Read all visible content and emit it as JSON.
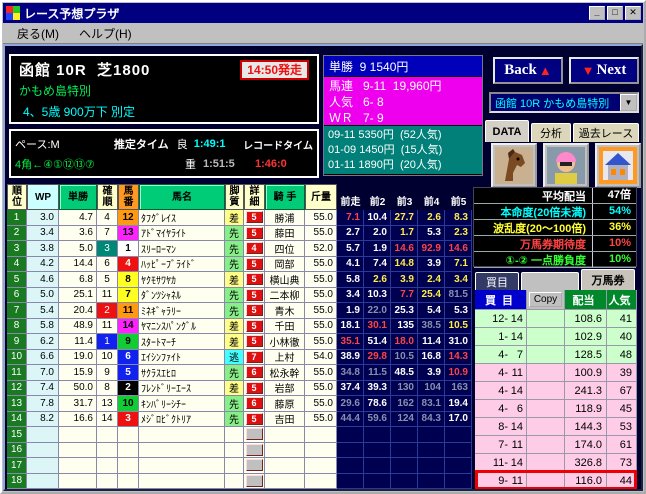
{
  "window": {
    "title": "レース予想プラザ",
    "menu": {
      "back": "戻る(M)",
      "help": "ヘルプ(H)"
    }
  },
  "race_info": {
    "title": "函館 10R  芝1800",
    "start_time": "14:50発走",
    "race_name": "かもめ島特別",
    "conditions": "4、5歳 900万下 別定"
  },
  "pace": {
    "pace": "ペース:M",
    "estimate_label": "推定タイム",
    "good_label": "良",
    "good_time": "1:49:1",
    "record_label": "レコードタイム",
    "corner_order": "4角←④①⑫⑬⑦",
    "heavy_label": "重",
    "heavy_time": "1:51:5",
    "record_time": "1:46:0"
  },
  "payouts": {
    "win": "単勝  9 1540円",
    "quinella": "馬連   9-11  19,960円",
    "popularity": "人気   6- 8",
    "wr": "ＷＲ   7- 9",
    "history": [
      "09-11 5350円  (52人気)",
      "01-09 1450円  (15人気)",
      "01-11 1890円  (20人気)"
    ]
  },
  "nav": {
    "back_label": "Back",
    "next_label": "Next",
    "race_selector": "函館 10R かもめ島特別",
    "tabs": {
      "data": "DATA",
      "analysis": "分析",
      "past": "過去レース"
    },
    "icons": [
      "horse-photo",
      "jockey-photo",
      "stable-photo"
    ]
  },
  "table": {
    "headers": {
      "rank": "順\n位",
      "wp": "WP",
      "odds": "単勝",
      "carank": "確\n順",
      "num": "馬\n番",
      "name": "馬名",
      "style": "脚\n質",
      "detail": "詳\n細",
      "jockey": "騎 手",
      "weight": "斤量",
      "past": [
        "前走",
        "前2",
        "前3",
        "前4",
        "前5"
      ]
    },
    "rows": [
      {
        "rank": "1",
        "wp": "3.0",
        "odds": "4.7",
        "co": "4",
        "co_mark": "",
        "num": "12",
        "num_color": "or",
        "name": "ﾀﾌｸﾞﾚｲｽ",
        "style": "差",
        "detail": "5",
        "jockey": "勝浦",
        "weight": "55.0",
        "past": [
          [
            "7.1",
            "r"
          ],
          [
            "10.4",
            "w"
          ],
          [
            "27.7",
            "y"
          ],
          [
            "2.6",
            "y"
          ],
          [
            "8.3",
            "y"
          ]
        ]
      },
      {
        "rank": "2",
        "wp": "3.4",
        "odds": "3.6",
        "co": "7",
        "co_mark": "",
        "num": "13",
        "num_color": "pk",
        "name": "ｱﾄﾞﾏｲﾔﾗｲﾄ",
        "style": "先",
        "detail": "5",
        "jockey": "藤田",
        "weight": "55.0",
        "past": [
          [
            "2.7",
            "w"
          ],
          [
            "2.0",
            "w"
          ],
          [
            "1.7",
            "y"
          ],
          [
            "5.3",
            "w"
          ],
          [
            "2.3",
            "y"
          ]
        ]
      },
      {
        "rank": "3",
        "wp": "3.8",
        "odds": "5.0",
        "co": "3",
        "co_mark": "q3",
        "num": "1",
        "num_color": "wh",
        "name": "ｽﾘｰﾛｰﾏﾝ",
        "style": "先",
        "detail": "4",
        "jockey": "四位",
        "weight": "52.0",
        "past": [
          [
            "5.7",
            "w"
          ],
          [
            "1.9",
            "w"
          ],
          [
            "14.6",
            "r"
          ],
          [
            "92.9",
            "r"
          ],
          [
            "14.6",
            "r"
          ]
        ]
      },
      {
        "rank": "4",
        "wp": "4.2",
        "odds": "14.4",
        "co": "6",
        "co_mark": "",
        "num": "4",
        "num_color": "rd",
        "name": "ﾊｯﾋﾟｰﾌﾞﾗｲﾄﾞ",
        "style": "先",
        "detail": "5",
        "jockey": "岡部",
        "weight": "55.0",
        "past": [
          [
            "4.1",
            "w"
          ],
          [
            "7.4",
            "w"
          ],
          [
            "14.8",
            "y"
          ],
          [
            "3.9",
            "w"
          ],
          [
            "7.1",
            "y"
          ]
        ]
      },
      {
        "rank": "5",
        "wp": "4.6",
        "odds": "6.8",
        "co": "5",
        "co_mark": "",
        "num": "8",
        "num_color": "yl",
        "name": "ﾔｸﾓｻﾜﾔｶ",
        "style": "差",
        "detail": "5",
        "jockey": "横山典",
        "weight": "55.0",
        "past": [
          [
            "5.8",
            "w"
          ],
          [
            "2.6",
            "y"
          ],
          [
            "3.9",
            "y"
          ],
          [
            "2.4",
            "y"
          ],
          [
            "3.4",
            "y"
          ]
        ]
      },
      {
        "rank": "6",
        "wp": "5.0",
        "odds": "25.1",
        "co": "11",
        "co_mark": "",
        "num": "7",
        "num_color": "yl",
        "name": "ﾀﾞﾝﾂｼｬﾈﾙ",
        "style": "先",
        "detail": "5",
        "jockey": "二本柳",
        "weight": "55.0",
        "past": [
          [
            "3.4",
            "w"
          ],
          [
            "10.3",
            "w"
          ],
          [
            "7.7",
            "r"
          ],
          [
            "25.4",
            "y"
          ],
          [
            "81.5",
            "g"
          ]
        ]
      },
      {
        "rank": "7",
        "wp": "5.4",
        "odds": "20.4",
        "co": "2",
        "co_mark": "q2",
        "num": "11",
        "num_color": "or",
        "name": "ﾐﾈｷﾞｬﾗﾘｰ",
        "style": "先",
        "detail": "5",
        "jockey": "青木",
        "weight": "55.0",
        "past": [
          [
            "1.9",
            "w"
          ],
          [
            "22.0",
            "g"
          ],
          [
            "25.3",
            "w"
          ],
          [
            "5.4",
            "w"
          ],
          [
            "5.3",
            "w"
          ]
        ]
      },
      {
        "rank": "8",
        "wp": "5.8",
        "odds": "48.9",
        "co": "11",
        "co_mark": "",
        "num": "14",
        "num_color": "pk",
        "name": "ﾔﾏﾆﾝｽﾊﾟﾝｸﾞﾙ",
        "style": "差",
        "detail": "5",
        "jockey": "千田",
        "weight": "55.0",
        "past": [
          [
            "18.1",
            "w"
          ],
          [
            "30.1",
            "r"
          ],
          [
            "135",
            "w"
          ],
          [
            "38.5",
            "g"
          ],
          [
            "10.5",
            "y"
          ]
        ]
      },
      {
        "rank": "9",
        "wp": "6.2",
        "odds": "11.4",
        "co": "1",
        "co_mark": "q1",
        "num": "9",
        "num_color": "gr",
        "name": "ｽﾀｰﾄﾏｰﾁ",
        "style": "差",
        "detail": "5",
        "jockey": "小林徹",
        "weight": "55.0",
        "past": [
          [
            "35.1",
            "r"
          ],
          [
            "51.4",
            "w"
          ],
          [
            "18.0",
            "r"
          ],
          [
            "11.4",
            "w"
          ],
          [
            "31.0",
            "w"
          ]
        ]
      },
      {
        "rank": "10",
        "wp": "6.6",
        "odds": "19.0",
        "co": "10",
        "co_mark": "",
        "num": "6",
        "num_color": "bl",
        "name": "ｴｲｼﾝﾌｧｲﾄ",
        "style": "逃",
        "detail": "7",
        "jockey": "上村",
        "weight": "54.0",
        "past": [
          [
            "38.9",
            "w"
          ],
          [
            "29.8",
            "r"
          ],
          [
            "10.5",
            "g"
          ],
          [
            "16.8",
            "w"
          ],
          [
            "14.3",
            "r"
          ]
        ]
      },
      {
        "rank": "11",
        "wp": "7.0",
        "odds": "15.9",
        "co": "9",
        "co_mark": "",
        "num": "5",
        "num_color": "bl",
        "name": "ｻｸﾗｽｴﾋﾛ",
        "style": "先",
        "detail": "6",
        "jockey": "松永幹",
        "weight": "55.0",
        "past": [
          [
            "34.8",
            "g"
          ],
          [
            "11.5",
            "g"
          ],
          [
            "48.5",
            "w"
          ],
          [
            "3.9",
            "w"
          ],
          [
            "10.9",
            "r"
          ]
        ]
      },
      {
        "rank": "12",
        "wp": "7.4",
        "odds": "50.0",
        "co": "8",
        "co_mark": "",
        "num": "2",
        "num_color": "bk",
        "name": "ﾌﾚﾝﾄﾞﾘｰｴｰｽ",
        "style": "差",
        "detail": "5",
        "jockey": "岩部",
        "weight": "55.0",
        "past": [
          [
            "37.4",
            "w"
          ],
          [
            "39.3",
            "w"
          ],
          [
            "130",
            "g"
          ],
          [
            "104",
            "g"
          ],
          [
            "163",
            "g"
          ]
        ]
      },
      {
        "rank": "13",
        "wp": "7.8",
        "odds": "31.7",
        "co": "13",
        "co_mark": "",
        "num": "10",
        "num_color": "gr",
        "name": "ｷﾝﾊﾞﾘｰｼﾁｰ",
        "style": "先",
        "detail": "6",
        "jockey": "藤原",
        "weight": "55.0",
        "past": [
          [
            "29.6",
            "g"
          ],
          [
            "78.6",
            "w"
          ],
          [
            "162",
            "g"
          ],
          [
            "83.1",
            "g"
          ],
          [
            "19.4",
            "w"
          ]
        ]
      },
      {
        "rank": "14",
        "wp": "8.2",
        "odds": "16.6",
        "co": "14",
        "co_mark": "",
        "num": "3",
        "num_color": "rd",
        "name": "ﾒｼﾞﾛﾋﾞｸﾄﾘｱ",
        "style": "先",
        "detail": "5",
        "jockey": "吉田",
        "weight": "55.0",
        "past": [
          [
            "44.4",
            "g"
          ],
          [
            "59.6",
            "g"
          ],
          [
            "124",
            "g"
          ],
          [
            "84.3",
            "g"
          ],
          [
            "17.0",
            "w"
          ]
        ]
      }
    ],
    "empty_ranks": [
      "15",
      "16",
      "17",
      "18"
    ]
  },
  "stats": {
    "rows": [
      {
        "label": "平均配当",
        "value": "47倍",
        "color": "#ffffff"
      },
      {
        "label": "本命度(20倍未満)",
        "value": "54%",
        "color": "#00ffff"
      },
      {
        "label": "波乱度(20～100倍)",
        "value": "36%",
        "color": "#ffff33"
      },
      {
        "label": "万馬券期待度",
        "value": "10%",
        "color": "#ff4444"
      },
      {
        "label": "①-② 一点勝負度",
        "value": "10%",
        "color": "#33ff33"
      }
    ]
  },
  "bets": {
    "tab_kaime": "買目",
    "tab_manbaken": "万馬券",
    "headers": {
      "pair": "買  目",
      "copy": "Copy",
      "payout": "配当",
      "pop": "人気"
    },
    "rows": [
      {
        "a": "12",
        "b": "14",
        "payout": "108.6",
        "pop": "41",
        "bg": "green",
        "hl": false
      },
      {
        "a": "1",
        "b": "14",
        "payout": "102.9",
        "pop": "40",
        "bg": "green",
        "hl": false
      },
      {
        "a": "4",
        "b": "7",
        "payout": "128.5",
        "pop": "48",
        "bg": "green",
        "hl": false
      },
      {
        "a": "4",
        "b": "11",
        "payout": "100.9",
        "pop": "39",
        "bg": "pink",
        "hl": false
      },
      {
        "a": "4",
        "b": "14",
        "payout": "241.3",
        "pop": "67",
        "bg": "pink",
        "hl": false
      },
      {
        "a": "4",
        "b": "6",
        "payout": "118.9",
        "pop": "45",
        "bg": "pink",
        "hl": false
      },
      {
        "a": "8",
        "b": "14",
        "payout": "144.3",
        "pop": "53",
        "bg": "pink",
        "hl": false
      },
      {
        "a": "7",
        "b": "11",
        "payout": "174.0",
        "pop": "61",
        "bg": "pink",
        "hl": false
      },
      {
        "a": "11",
        "b": "14",
        "payout": "326.8",
        "pop": "73",
        "bg": "pink",
        "hl": false
      },
      {
        "a": "9",
        "b": "11",
        "payout": "116.0",
        "pop": "44",
        "bg": "pink",
        "hl": true
      }
    ]
  },
  "colors": {
    "title_bar": "#000080",
    "win_bar": "#0000bb",
    "quinella_bg": "#ee00ee",
    "history_bg": "#008078",
    "highlight_red": "#ee0000",
    "bet_green_row": "#ccffcc",
    "bet_pink_row": "#ffcce8"
  }
}
